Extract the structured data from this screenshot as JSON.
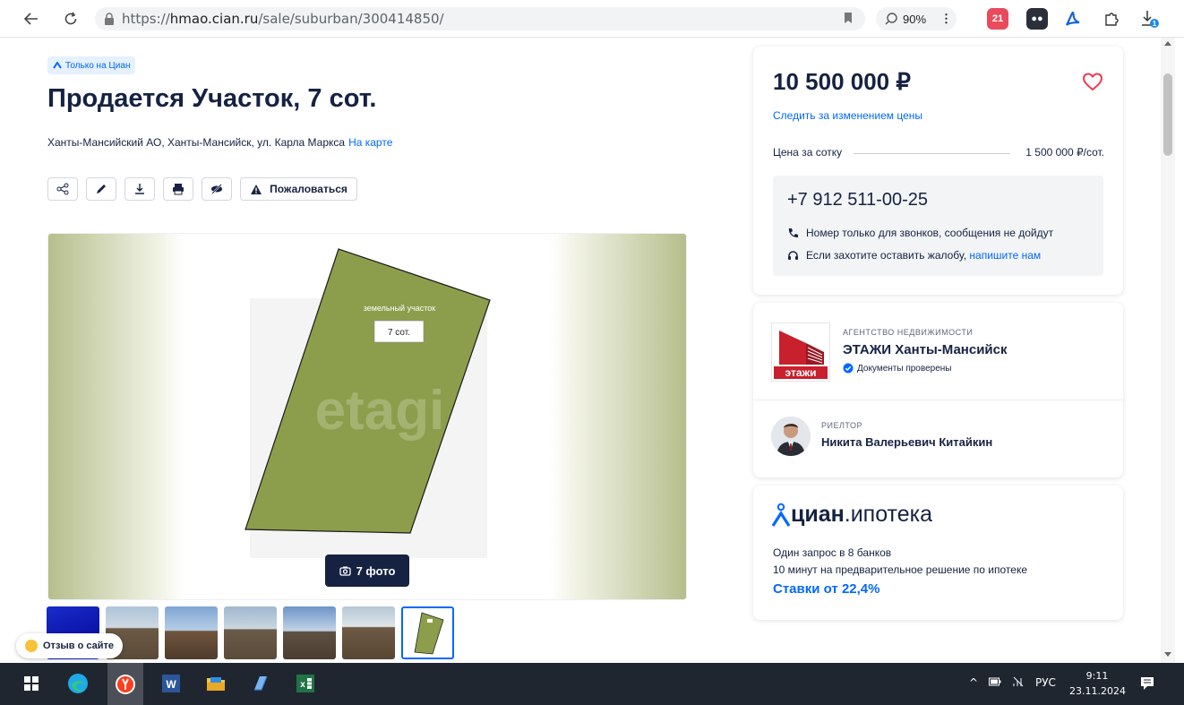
{
  "browser": {
    "url_prefix": "https://",
    "url_host": "hmao.cian.ru",
    "url_path": "/sale/suburban/300414850/",
    "zoom": "90%",
    "extension_badge": "21"
  },
  "listing": {
    "badge": "Только на Циан",
    "title": "Продается Участок, 7 сот.",
    "address": "Ханты-Мансийский АО, Ханты-Мансийск, ул. Карла Маркса",
    "map_link": "На карте",
    "report_label": "Пожаловаться",
    "gallery": {
      "plot_label": "земельный участок",
      "plot_size": "7 сот.",
      "watermark": "etagi",
      "photos_button": "7 фото"
    }
  },
  "price_card": {
    "price": "10 500 000 ₽",
    "follow_price": "Следить за изменением цены",
    "per_hundred_label": "Цена за сотку",
    "per_hundred_value": "1 500 000 ₽/сот.",
    "phone": "+7 912 511-00-25",
    "note_calls": "Номер только для звонков, сообщения не дойдут",
    "note_complaint": "Если захотите оставить жалобу,",
    "note_complaint_link": "напишите нам"
  },
  "agency": {
    "type": "АГЕНТСТВО НЕДВИЖИМОСТИ",
    "name": "ЭТАЖИ Ханты-Мансийск",
    "verified": "Документы проверены",
    "logo_text": "этажи",
    "realtor_type": "РИЕЛТОР",
    "realtor_name": "Никита Валерьевич Китайкин"
  },
  "mortgage": {
    "brand": "циан",
    "product": ".ипотека",
    "line1": "Один запрос в 8 банков",
    "line2": "10 минут на предварительное решение по ипотеке",
    "rate": "Ставки от 22,4%"
  },
  "feedback": "Отзыв о сайте",
  "taskbar": {
    "lang": "РУС",
    "time": "9:11",
    "date": "23.11.2024"
  },
  "colors": {
    "accent": "#0468ff",
    "text": "#152242",
    "plot": "#8c9e4b",
    "heart": "#ef3a4d"
  }
}
